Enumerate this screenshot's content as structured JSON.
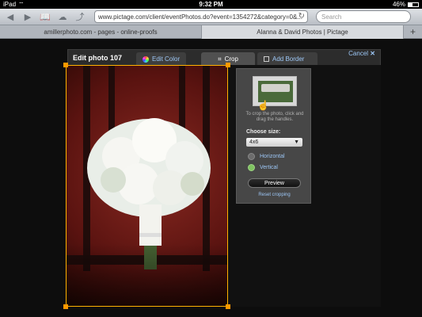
{
  "status": {
    "device": "iPad",
    "time": "9:32 PM",
    "battery": "46%"
  },
  "browser": {
    "url": "www.pictage.com/client/eventPhotos.do?event=1354272&category=0&...",
    "search_placeholder": "Search",
    "tabs": [
      {
        "label": "amillerphoto.com - pages - online-proofs"
      },
      {
        "label": "Alanna & David Photos | Pictage"
      }
    ]
  },
  "editor": {
    "title": "Edit photo 107",
    "tabs": [
      {
        "label": "Edit Color"
      },
      {
        "label": "Crop"
      },
      {
        "label": "Add Border"
      }
    ],
    "cancel_label": "Cancel"
  },
  "crop_panel": {
    "instruction": "To crop the photo, click and drag the handles.",
    "choose_size_label": "Choose size:",
    "selected_size": "4x6",
    "orientation_options": [
      {
        "label": "Horizontal",
        "selected": false
      },
      {
        "label": "Vertical",
        "selected": true
      }
    ],
    "preview_label": "Preview",
    "reset_label": "Reset cropping"
  },
  "colors": {
    "crop_frame": "#ffb200",
    "link": "#9cc6f5",
    "panel_bg": "#474747"
  }
}
